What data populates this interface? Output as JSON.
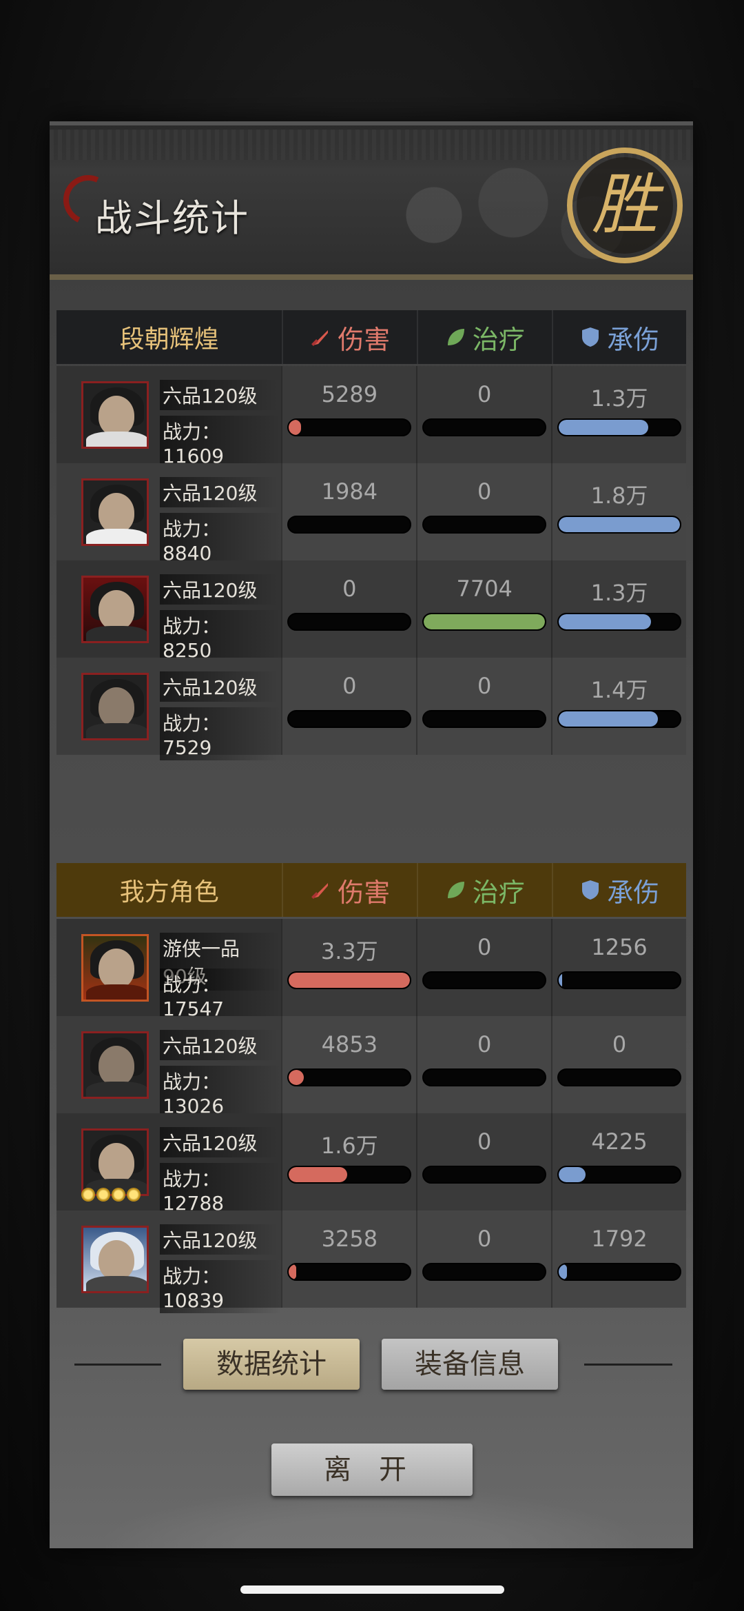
{
  "title": "战斗统计",
  "result_seal": "胜",
  "columns": {
    "damage": "伤害",
    "healing": "治疗",
    "tanking": "承伤"
  },
  "enemy_team": {
    "name": "段朝辉煌",
    "members": [
      {
        "level": "六品120级",
        "power": "战力：11609",
        "damage": "5289",
        "healing": "0",
        "tanking": "1.3万",
        "damage_fill": 0.1,
        "healing_fill": 0,
        "tanking_fill": 0.74
      },
      {
        "level": "六品120级",
        "power": "战力：8840",
        "damage": "1984",
        "healing": "0",
        "tanking": "1.8万",
        "damage_fill": 0,
        "healing_fill": 0,
        "tanking_fill": 1.0
      },
      {
        "level": "六品120级",
        "power": "战力：8250",
        "damage": "0",
        "healing": "7704",
        "tanking": "1.3万",
        "damage_fill": 0,
        "healing_fill": 1.0,
        "tanking_fill": 0.76
      },
      {
        "level": "六品120级",
        "power": "战力：7529",
        "damage": "0",
        "healing": "0",
        "tanking": "1.4万",
        "damage_fill": 0,
        "healing_fill": 0,
        "tanking_fill": 0.82
      }
    ]
  },
  "ally_team": {
    "name": "我方角色",
    "members": [
      {
        "level": "游侠一品90级",
        "power": "战力：17547",
        "damage": "3.3万",
        "healing": "0",
        "tanking": "1256",
        "damage_fill": 1.0,
        "healing_fill": 0,
        "tanking_fill": 0.03
      },
      {
        "level": "六品120级",
        "power": "战力：13026",
        "damage": "4853",
        "healing": "0",
        "tanking": "0",
        "damage_fill": 0.12,
        "healing_fill": 0,
        "tanking_fill": 0
      },
      {
        "level": "六品120级",
        "power": "战力：12788",
        "damage": "1.6万",
        "healing": "0",
        "tanking": "4225",
        "damage_fill": 0.48,
        "healing_fill": 0,
        "tanking_fill": 0.22
      },
      {
        "level": "六品120级",
        "power": "战力：10839",
        "damage": "3258",
        "healing": "0",
        "tanking": "1792",
        "damage_fill": 0.06,
        "healing_fill": 0,
        "tanking_fill": 0.07
      }
    ]
  },
  "buttons": {
    "stats": "数据统计",
    "equipment": "装备信息",
    "leave": "离开"
  },
  "colors": {
    "damage": "#d56a5e",
    "healing": "#7faa5c",
    "tanking": "#7a9ccf",
    "ally_header": "#4e3a0c",
    "enemy_header": "#1e1f21"
  }
}
